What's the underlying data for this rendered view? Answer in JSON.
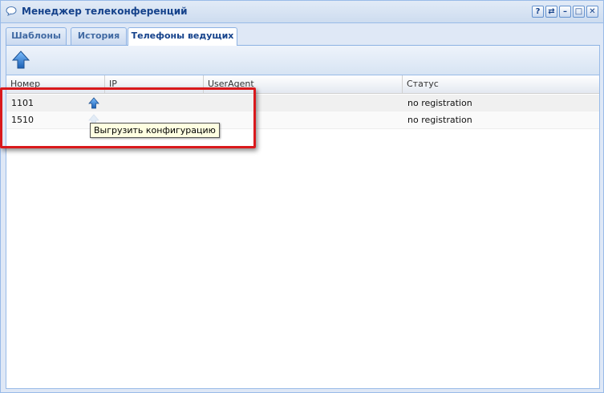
{
  "window": {
    "title": "Менеджер телеконференций",
    "tools": [
      {
        "icon": "help-icon",
        "glyph": "?"
      },
      {
        "icon": "refresh-icon",
        "glyph": "⇄"
      },
      {
        "icon": "minimize-icon",
        "glyph": "–"
      },
      {
        "icon": "maximize-icon",
        "glyph": "□"
      },
      {
        "icon": "close-icon",
        "glyph": "✕"
      }
    ]
  },
  "tabs": [
    {
      "label": "Шаблоны",
      "active": false
    },
    {
      "label": "История",
      "active": false
    },
    {
      "label": "Телефоны ведущих",
      "active": true
    }
  ],
  "toolbar": {
    "upload_icon": "arrow-up-icon"
  },
  "grid": {
    "columns": [
      "Номер",
      "IP",
      "UserAgent",
      "Статус"
    ],
    "rows": [
      {
        "number": "1101",
        "ip": "",
        "user_agent": "",
        "status": "no registration"
      },
      {
        "number": "1510",
        "ip": "",
        "user_agent": "",
        "status": "no registration"
      }
    ]
  },
  "tooltip": {
    "text": "Выгрузить конфигурацию"
  },
  "colors": {
    "highlight": "#d9191c",
    "header_text": "#15428b",
    "border": "#99bbe8"
  }
}
